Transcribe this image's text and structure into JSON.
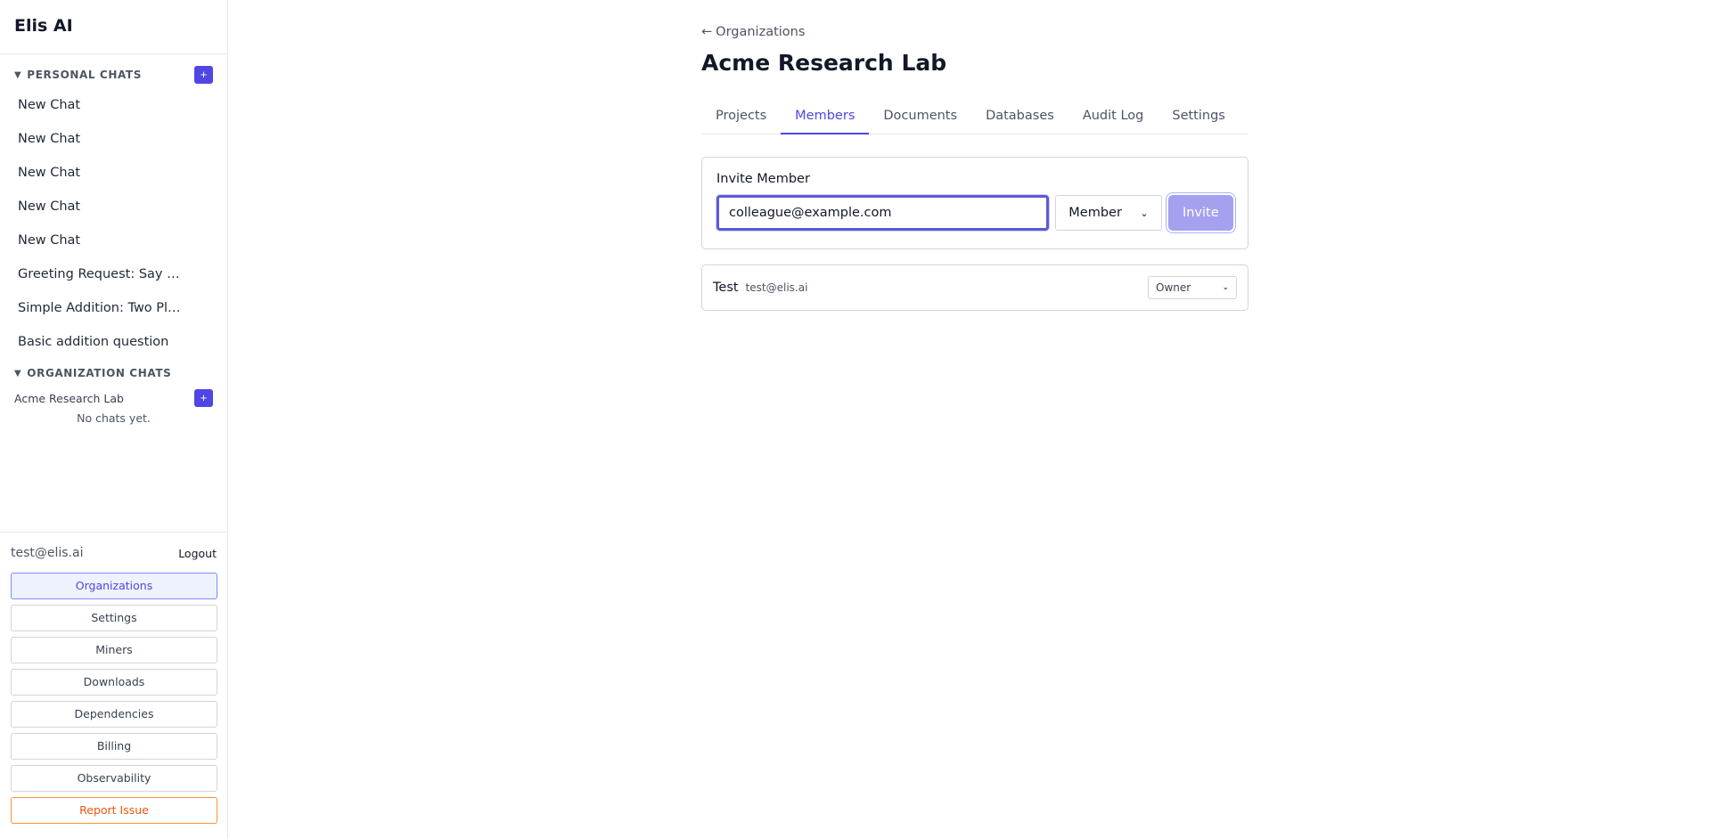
{
  "sidebar": {
    "brand": "Elis AI",
    "personal_section": {
      "title": "PERSONAL CHATS",
      "add_label": "+",
      "chats": [
        "New Chat",
        "New Chat",
        "New Chat",
        "New Chat",
        "New Chat",
        "Greeting Request: Say …",
        "Simple Addition: Two Pl…",
        "Basic addition question"
      ]
    },
    "org_section": {
      "title": "ORGANIZATION CHATS",
      "org_name": "Acme Research Lab",
      "add_label": "+",
      "empty_text": "No chats yet."
    },
    "user_email": "test@elis.ai",
    "logout_label": "Logout",
    "nav": {
      "organizations": "Organizations",
      "settings": "Settings",
      "miners": "Miners",
      "downloads": "Downloads",
      "dependencies": "Dependencies",
      "billing": "Billing",
      "observability": "Observability",
      "report_issue": "Report Issue"
    }
  },
  "main": {
    "back_label": "Organizations",
    "title": "Acme Research Lab",
    "tabs": [
      "Projects",
      "Members",
      "Documents",
      "Databases",
      "Audit Log",
      "Settings"
    ],
    "active_tab": "Members",
    "invite": {
      "title": "Invite Member",
      "email_value": "colleague@example.com",
      "role_value": "Member",
      "button_label": "Invite"
    },
    "members": [
      {
        "name": "Test",
        "email": "test@elis.ai",
        "role": "Owner"
      }
    ]
  },
  "colors": {
    "accent": "#4f46e5",
    "invite_button_disabled": "#a5a1ee",
    "report_issue": "#ea580c"
  }
}
